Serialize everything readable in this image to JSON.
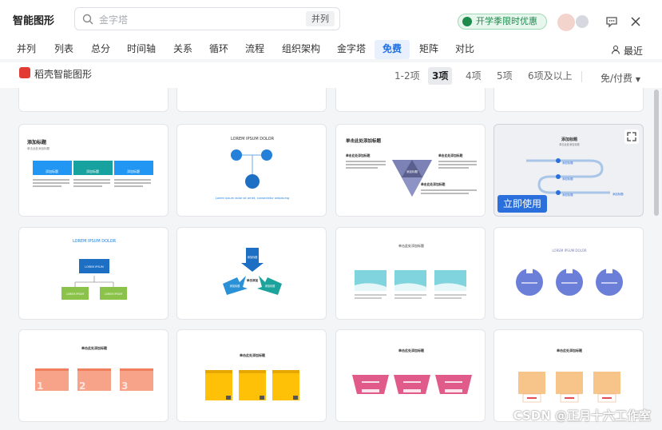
{
  "app": {
    "title": "智能图形"
  },
  "search": {
    "placeholder": "金字塔",
    "tag": "并列"
  },
  "promo": {
    "label": "开学季限时优惠"
  },
  "tabs": [
    "并列",
    "列表",
    "总分",
    "时间轴",
    "关系",
    "循环",
    "流程",
    "组织架构",
    "金字塔",
    "免费",
    "矩阵",
    "对比"
  ],
  "active_tab": "免费",
  "latest_label": "最近",
  "brand": {
    "label": "稻壳智能图形"
  },
  "count_filters": [
    "1-2项",
    "3项",
    "4项",
    "5项",
    "6项及以上"
  ],
  "active_count": "3项",
  "fee_filter": "免/付费",
  "card": {
    "use_label": "立即使用"
  },
  "thumbs": {
    "t1": {
      "title": "添加标题",
      "sub": "单击此处添加标题",
      "l1": "添加标题",
      "l2": "添加标题",
      "l3": "添加标题"
    },
    "t2": {
      "title": "LOREM IPSUM DOLOR",
      "foot": "Lorem ipsum dolor sit amet, consectetur adipiscing"
    },
    "t3": {
      "title": "单击此处添加标题",
      "l1": "单击此处添加标题",
      "l2": "单击此处添加标题",
      "l3": "单击此处添加标题",
      "c": "添加标题"
    },
    "t4": {
      "title": "添加标题",
      "sub": "单击此处添加标题",
      "l1": "添加标题",
      "l2": "添加标题",
      "l3": "添加标题",
      "tail": "添加标题"
    },
    "t5": {
      "title": "LOREM IPSUM DOLOR",
      "top": "LOREM IPSUM",
      "l1": "LOREM IPSUM",
      "l2": "LOREM IPSUM"
    },
    "t6": {
      "a": "添加标题",
      "b": "添加标题",
      "c": "添加标题",
      "center": "单击添加"
    },
    "t7": {
      "title": "单击此处添加标题"
    },
    "t8": {
      "title": "LOREM IPSUM DOLOR"
    },
    "t9": {
      "title": "单击此处添加标题"
    },
    "t10": {
      "title": "单击此处添加标题"
    },
    "t11": {
      "title": "单击此处添加标题"
    },
    "t12": {
      "title": "单击此处添加标题"
    }
  },
  "watermark": "CSDN @正月十六工作室"
}
